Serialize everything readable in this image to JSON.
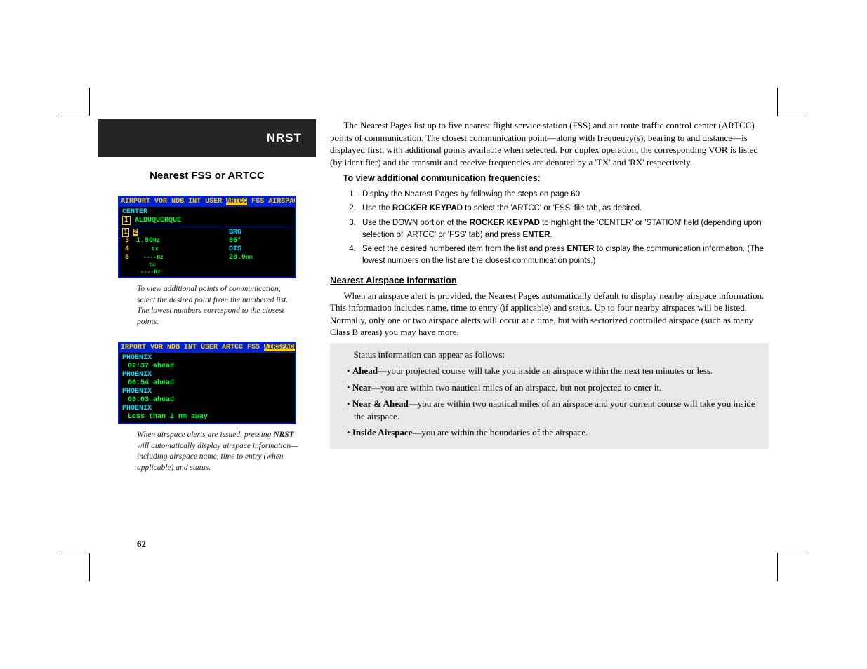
{
  "header": {
    "section": "NRST",
    "subtitle": "Nearest FSS or ARTCC"
  },
  "screen1": {
    "tabs": [
      "AIRPORT",
      "VOR",
      "NDB",
      "INT",
      "USER",
      "ARTCC",
      "FSS",
      "AIRSPACE"
    ],
    "active_tab": "ARTCC",
    "label_center": "CENTER",
    "selected_index": "1",
    "name": "ALBUQUERQUE",
    "freq_label": "BRG",
    "freq_value": "1.50",
    "freq_unit": "Hz",
    "brg_value": "86°",
    "dis_label": "DIS",
    "dis_value": "28.9",
    "dis_unit": "nm",
    "notes": [
      "tx",
      "----Hz",
      "tx",
      "----Hz"
    ],
    "index_col": [
      "1",
      "2",
      "3",
      "4",
      "5"
    ]
  },
  "caption1": "To view additional points of communication, select the desired point from the numbered list. The lowest numbers correspond to the closest points.",
  "screen2": {
    "tabs_left": "IRPORT VOR NDB INT USER ARTCC FSS",
    "tab_active": "AIRSPACE",
    "tabs_right": "C",
    "rows": [
      {
        "name": "PHOENIX",
        "status": "02:37 ahead"
      },
      {
        "name": "PHOENIX",
        "status": "06:54 ahead"
      },
      {
        "name": "PHOENIX",
        "status": "09:03 ahead"
      },
      {
        "name": "PHOENIX",
        "status": "Less than 2 nm away"
      }
    ]
  },
  "caption2_a": "When airspace alerts are issued, pressing ",
  "caption2_key": "NRST",
  "caption2_b": " will automatically display airspace information—including airspace name, time to entry (when applicable) and status.",
  "body": {
    "intro": "The Nearest Pages list up to five nearest flight service station (FSS) and air route traffic control center (ARTCC) points of communication. The closest communication point—along with frequency(s), bearing to and distance—is displayed first, with additional points available when selected. For duplex operation, the corresponding VOR is listed (by identifier) and the transmit and receive frequencies are denoted by a 'TX' and 'RX' respectively.",
    "proc_title": "To view additional communication frequencies:",
    "steps": [
      {
        "a": "Display the Nearest Pages by following the steps on page 60."
      },
      {
        "a": "Use the ",
        "k1": "ROCKER KEYPAD",
        "b": " to select the 'ARTCC' or 'FSS' file tab, as desired."
      },
      {
        "a": "Use the DOWN portion of the ",
        "k1": "ROCKER KEYPAD",
        "b": " to highlight the 'CENTER' or 'STATION' field (depending upon selection of 'ARTCC' or 'FSS' tab) and press ",
        "k2": "ENTER",
        "c": "."
      },
      {
        "a": "Select the desired numbered item from the list and press ",
        "k1": "ENTER",
        "b": " to display the communication information. (The lowest numbers on the list are the closest communication points.)"
      }
    ],
    "section2_title": "Nearest Airspace Information",
    "section2_para": "When an airspace alert is provided, the Nearest Pages automatically default to display nearby airspace information. This information includes name, time to entry (if applicable) and status. Up to four nearby airspaces will be listed. Normally, only one or two airspace alerts will occur at a time, but with sectorized controlled airspace (such as many Class B areas) you may have more.",
    "status_lead": "Status information can appear as follows:",
    "status": [
      {
        "k": "Ahead—",
        "t": "your projected course will take you inside an airspace within the next ten minutes or less."
      },
      {
        "k": "Near—",
        "t": "you are within two nautical miles of an airspace, but not projected to enter it."
      },
      {
        "k": "Near & Ahead—",
        "t": "you are within two nautical miles of an airspace and your current course will take you inside the airspace."
      },
      {
        "k": "Inside Airspace—",
        "t": "you are within the boundaries of the airspace."
      }
    ]
  },
  "page_num": "62"
}
